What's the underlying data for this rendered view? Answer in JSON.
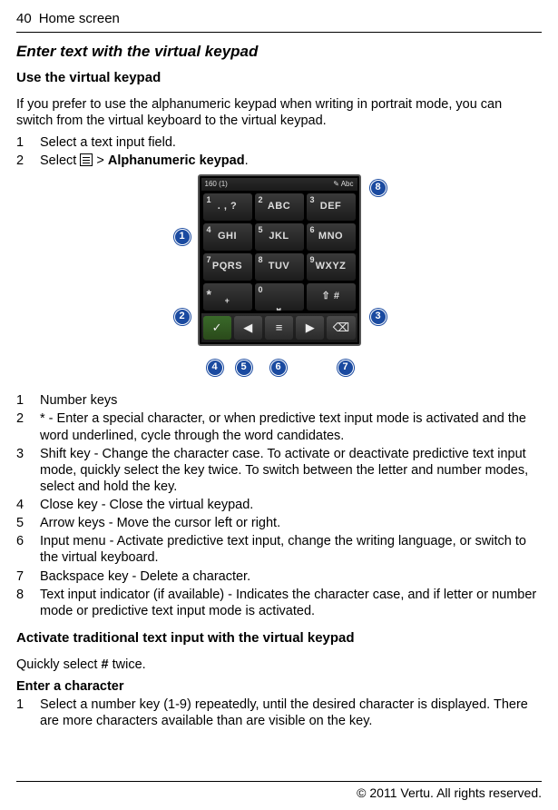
{
  "header": {
    "page_number": "40",
    "section": "Home screen"
  },
  "h1": "Enter text with the virtual keypad",
  "h2": "Use the virtual keypad",
  "intro": "If you prefer to use the alphanumeric keypad when writing in portrait mode, you can switch from the virtual keyboard to the virtual keypad.",
  "steps": {
    "s1_num": "1",
    "s1_text": "Select a text input field.",
    "s2_num": "2",
    "s2_pre": "Select ",
    "s2_gt": " > ",
    "s2_bold": "Alphanumeric keypad",
    "s2_dot": "."
  },
  "keypad": {
    "status_left": "160 (1)",
    "status_right": "Abc",
    "keys": [
      {
        "n": "1",
        "l": ". , ?"
      },
      {
        "n": "2",
        "l": "ABC"
      },
      {
        "n": "3",
        "l": "DEF"
      },
      {
        "n": "4",
        "l": "GHI"
      },
      {
        "n": "5",
        "l": "JKL"
      },
      {
        "n": "6",
        "l": "MNO"
      },
      {
        "n": "7",
        "l": "PQRS"
      },
      {
        "n": "8",
        "l": "TUV"
      },
      {
        "n": "9",
        "l": "WXYZ"
      },
      {
        "n": "*",
        "l": "+"
      },
      {
        "n": "0",
        "l": ""
      },
      {
        "n": "",
        "l": "⇧  #"
      }
    ],
    "bottom": {
      "check": "✓",
      "left": "◀",
      "menu": "≡",
      "right": "▶",
      "backspace": "⌫"
    },
    "callouts": {
      "c1": "1",
      "c2": "2",
      "c3": "3",
      "c4": "4",
      "c5": "5",
      "c6": "6",
      "c7": "7",
      "c8": "8"
    }
  },
  "legend": {
    "i1_num": "1",
    "i1_text": "Number keys",
    "i2_num": "2",
    "i2_text": "* - Enter a special character, or when predictive text input mode is activated and the word underlined, cycle through the word candidates.",
    "i3_num": "3",
    "i3_text": "Shift key - Change the character case. To activate or deactivate predictive text input mode, quickly select the key twice. To switch between the letter and number modes, select and hold the key.",
    "i4_num": "4",
    "i4_text": "Close key - Close the virtual keypad.",
    "i5_num": "5",
    "i5_text": "Arrow keys - Move the cursor left or right.",
    "i6_num": "6",
    "i6_text": "Input menu - Activate predictive text input, change the writing language, or switch to the virtual keyboard.",
    "i7_num": "7",
    "i7_text": "Backspace key - Delete a character.",
    "i8_num": "8",
    "i8_text": "Text input indicator (if available) - Indicates the character case, and if letter or number mode or predictive text input mode is activated."
  },
  "h3": "Activate traditional text input with the virtual keypad",
  "activate_text_pre": "Quickly select ",
  "activate_bold": "#",
  "activate_text_post": " twice.",
  "h4": "Enter a character",
  "enter_char": {
    "num": "1",
    "text": "Select a number key (1-9) repeatedly, until the desired character is displayed. There are more characters available than are visible on the key."
  },
  "footer": "© 2011 Vertu. All rights reserved."
}
